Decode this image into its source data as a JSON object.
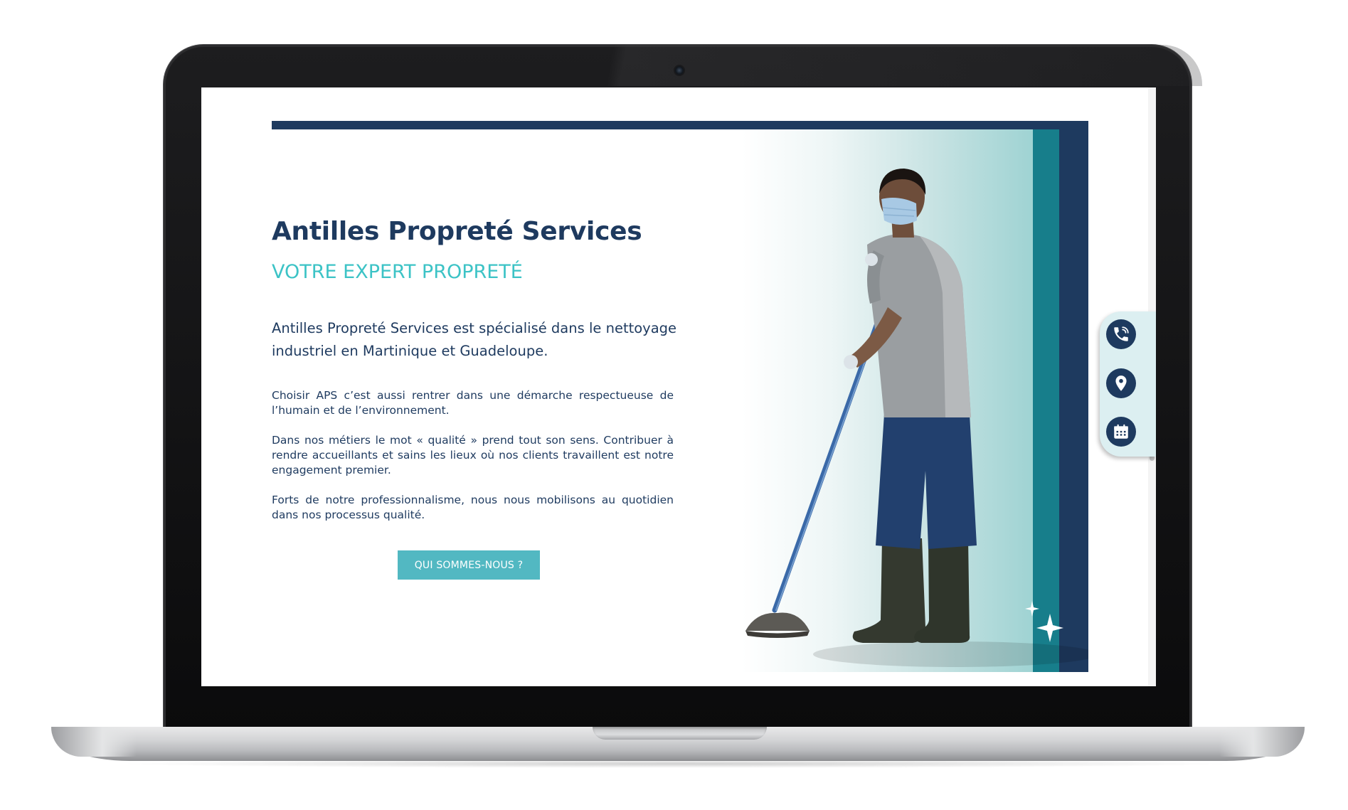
{
  "hero": {
    "title": "Antilles Propreté Services",
    "subtitle": "VOTRE EXPERT PROPRETÉ",
    "lead": "Antilles Propreté Services est spécialisé dans le nettoyage industriel en Martinique et Guadeloupe.",
    "paragraphs": [
      "Choisir APS c’est aussi rentrer dans une démarche respectueuse de l’humain et de l’environnement.",
      "Dans nos métiers le mot « qualité » prend tout son sens. Contribuer à rendre accueillants et sains les lieux où nos clients travaillent est notre engagement premier.",
      "Forts de notre professionnalisme, nous nous mobilisons au quotidien dans nos processus qualité."
    ],
    "cta_label": "QUI SOMMES-NOUS ?"
  },
  "image": {
    "subject": "worker-mopping-photo",
    "alt": ""
  },
  "contact_dock": {
    "items": [
      {
        "icon": "phone-icon"
      },
      {
        "icon": "location-pin-icon"
      },
      {
        "icon": "calendar-icon"
      }
    ]
  },
  "colors": {
    "navy": "#1e3a5f",
    "teal": "#177e8b",
    "accent": "#3cc3c6",
    "button": "#52b8c2",
    "dock_bg": "#dceff1"
  }
}
